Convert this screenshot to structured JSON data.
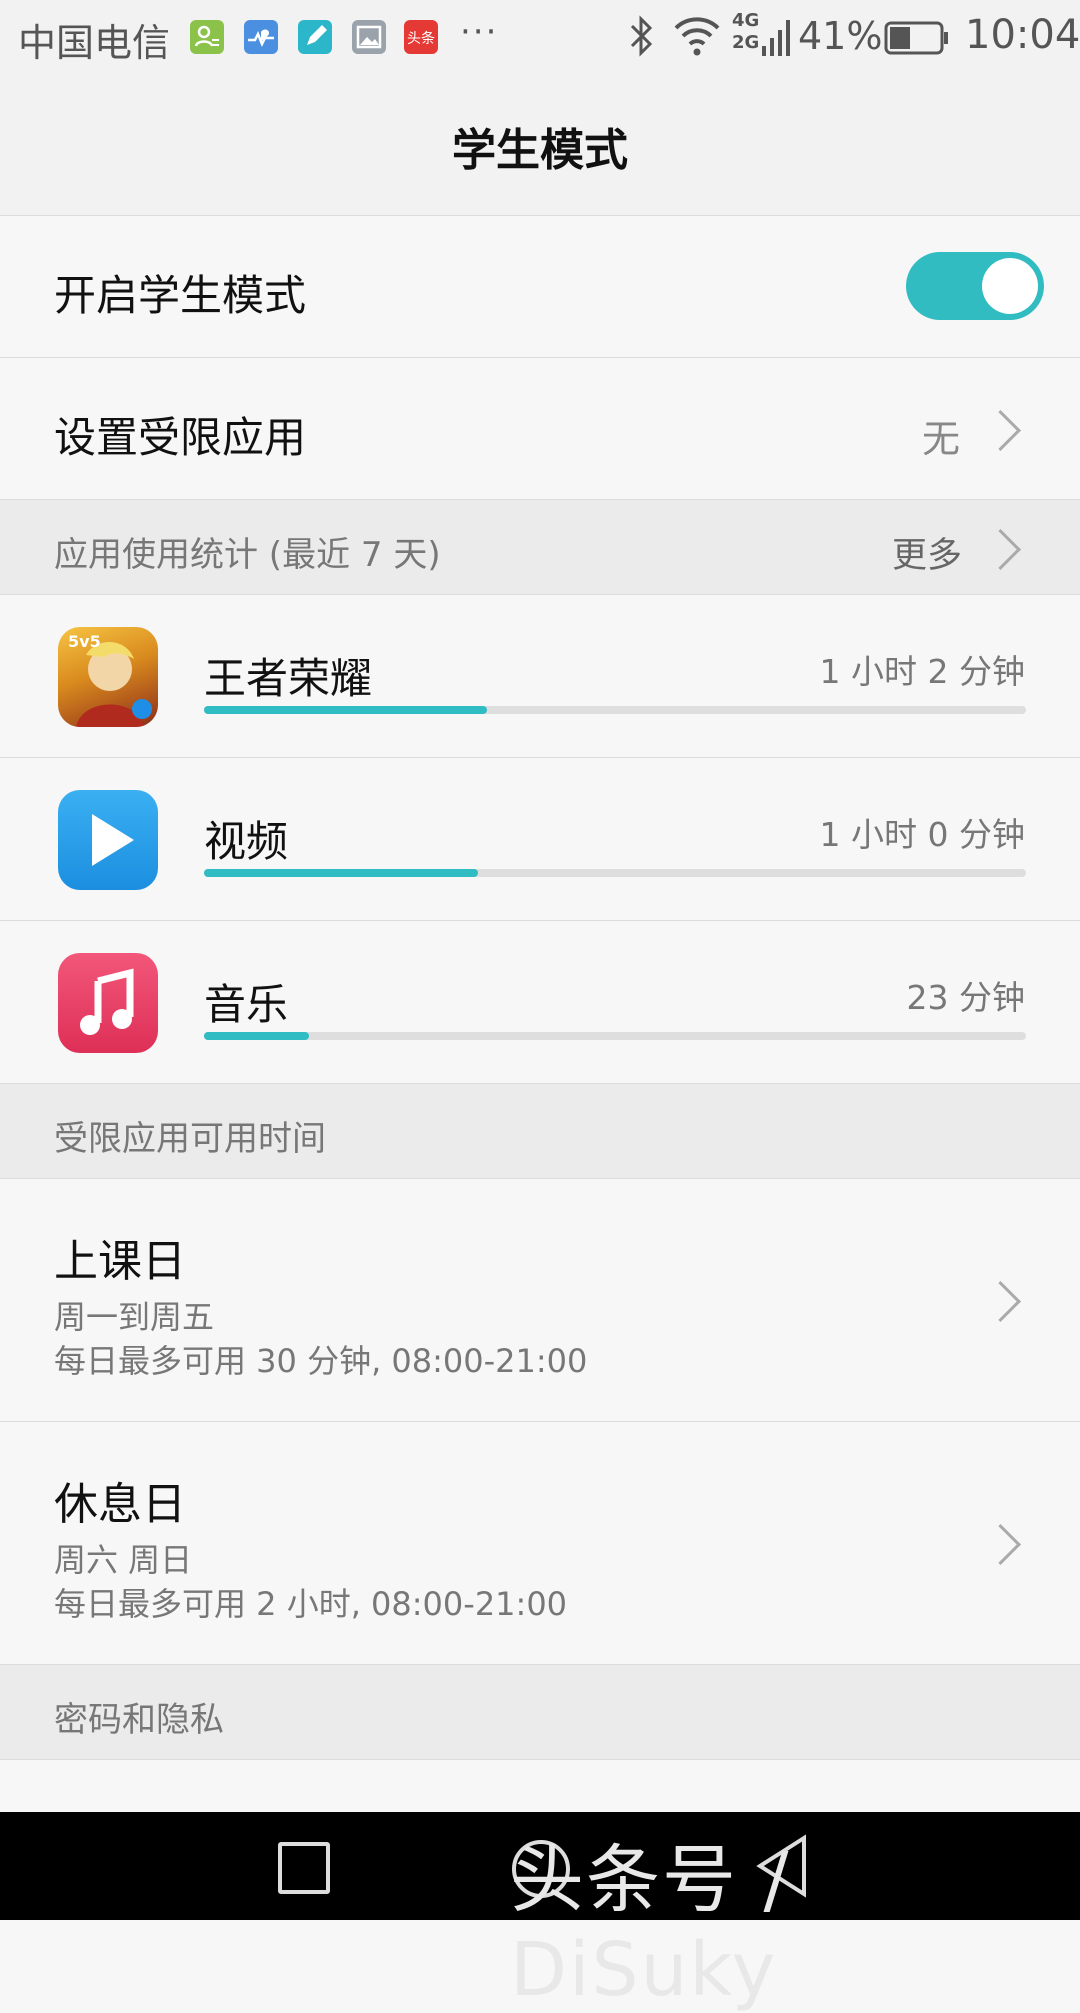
{
  "status_bar": {
    "carrier": "中国电信",
    "notification_icons": [
      {
        "icon": "contacts-icon",
        "color": "#8bc34a"
      },
      {
        "icon": "health-icon",
        "color": "#4a8fe0"
      },
      {
        "icon": "notes-icon",
        "color": "#2bb6c9"
      },
      {
        "icon": "gallery-icon",
        "color": "#9aa3ab"
      },
      {
        "icon": "toutiao-icon",
        "color": "#e53935",
        "text": "头条"
      }
    ],
    "more": "···",
    "network_top": "4G",
    "network_bottom": "2G",
    "battery": "41%",
    "battery_level": 0.41,
    "time": "10:04"
  },
  "header": {
    "title": "学生模式"
  },
  "settings": {
    "enable_label": "开启学生模式",
    "enable_on": true,
    "restricted_apps_label": "设置受限应用",
    "restricted_apps_value": "无"
  },
  "usage": {
    "section_title": "应用使用统计 (最近 7 天)",
    "more_label": "更多",
    "apps": [
      {
        "name": "王者荣耀",
        "time": "1 小时 2 分钟",
        "minutes": 62,
        "icon": "game-icon"
      },
      {
        "name": "视频",
        "time": "1 小时 0 分钟",
        "minutes": 60,
        "icon": "play-icon"
      },
      {
        "name": "音乐",
        "time": "23 分钟",
        "minutes": 23,
        "icon": "music-note-icon"
      }
    ]
  },
  "available_time": {
    "section_title": "受限应用可用时间",
    "school_day": {
      "title": "上课日",
      "days": "周一到周五",
      "limit": "每日最多可用 30 分钟, 08:00-21:00"
    },
    "rest_day": {
      "title": "休息日",
      "days": "周六 周日",
      "limit": "每日最多可用 2 小时, 08:00-21:00"
    }
  },
  "privacy": {
    "section_title": "密码和隐私"
  },
  "watermark": "头条号 / DiSuky"
}
